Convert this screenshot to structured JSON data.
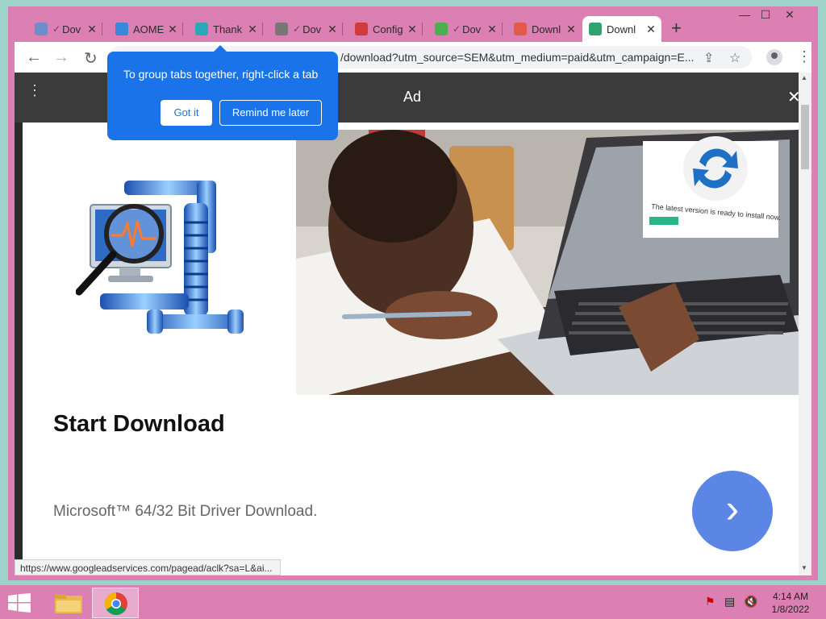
{
  "browser": {
    "tabs": [
      {
        "title": "Dov",
        "checked": true,
        "fav_color": "#6d8fc9"
      },
      {
        "title": "AOME",
        "checked": false,
        "fav_color": "#3a86d9"
      },
      {
        "title": "Thank",
        "checked": false,
        "fav_color": "#2aa9b8"
      },
      {
        "title": "Dov",
        "checked": true,
        "fav_color": "#777777"
      },
      {
        "title": "Config",
        "checked": false,
        "fav_color": "#d23a3a"
      },
      {
        "title": "Dov",
        "checked": true,
        "fav_color": "#4caf50"
      },
      {
        "title": "Downl",
        "checked": false,
        "fav_color": "#e25b4a"
      },
      {
        "title": "Downl",
        "checked": false,
        "fav_color": "#30a46c",
        "active": true
      }
    ],
    "close_glyph": "✕",
    "check_glyph": "✓",
    "new_tab_glyph": "+",
    "window_controls": {
      "minimize": "—",
      "maximize": "☐",
      "close": "✕"
    },
    "nav": {
      "back": "←",
      "forward": "→",
      "reload": "↻"
    },
    "url": "/download?utm_source=SEM&utm_medium=paid&utm_campaign=E...",
    "omnibox_icons": {
      "share": "⇪",
      "bookmark": "☆"
    },
    "menu": "⋮"
  },
  "tooltip": {
    "message": "To group tabs together, right-click a tab",
    "got_it": "Got it",
    "remind_later": "Remind me later"
  },
  "ad": {
    "bar_title": "Ad",
    "close": "✕",
    "menu": "⋮",
    "headline": "Start Download",
    "description": "Microsoft™ 64/32 Bit Driver Download.",
    "next_glyph": "›",
    "popup_text": "The latest version is ready to install now."
  },
  "status_bar": {
    "url": "https://www.googleadservices.com/pagead/aclk?sa=L&ai..."
  },
  "taskbar": {
    "tray_icons": [
      "flag-icon",
      "network-icon",
      "volume-muted-icon"
    ],
    "time": "4:14 AM",
    "date": "1/8/2022"
  }
}
